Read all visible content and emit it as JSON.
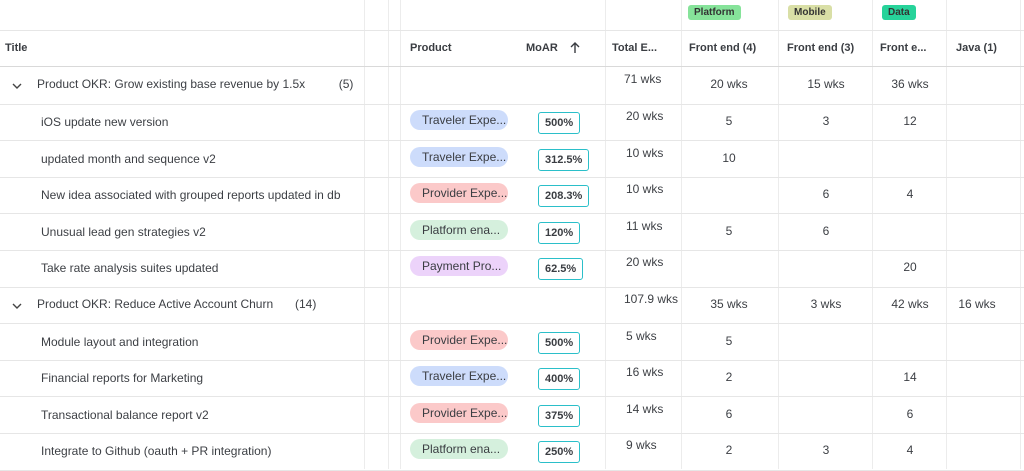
{
  "teams": [
    {
      "label": "Platform",
      "color": "#86e39a"
    },
    {
      "label": "Mobile",
      "color": "#d9dfa6"
    },
    {
      "label": "Data",
      "color": "#27d39a"
    }
  ],
  "columns": {
    "title": "Title",
    "product": "Product",
    "moar": "MoAR",
    "total": "Total E...",
    "fe_platform": "Front end (4)",
    "fe_mobile": "Front end (3)",
    "fe_data": "Front e...",
    "java": "Java (1)"
  },
  "colors": {
    "traveler": "#cddcfb",
    "provider": "#fbc9c9",
    "platform": "#d5f0dd",
    "payment": "#ecd3fa",
    "moar_border": "#2bbfc9"
  },
  "groups": [
    {
      "title": "Product OKR: Grow existing base revenue by 1.5x",
      "count": "(5)",
      "total": "71 wks",
      "fe_platform": "20 wks",
      "fe_mobile": "15 wks",
      "fe_data": "36 wks",
      "java": "",
      "rows": [
        {
          "title": "iOS update new version",
          "product": "Traveler Expe...",
          "kind": "traveler",
          "moar": "500%",
          "total": "20 wks",
          "fe_platform": "5",
          "fe_mobile": "3",
          "fe_data": "12",
          "java": ""
        },
        {
          "title": "updated month and sequence v2",
          "product": "Traveler Expe...",
          "kind": "traveler",
          "moar": "312.5%",
          "total": "10 wks",
          "fe_platform": "10",
          "fe_mobile": "",
          "fe_data": "",
          "java": ""
        },
        {
          "title": "New idea associated with grouped reports updated in db",
          "product": "Provider Expe...",
          "kind": "provider",
          "moar": "208.3%",
          "total": "10 wks",
          "fe_platform": "",
          "fe_mobile": "6",
          "fe_data": "4",
          "java": ""
        },
        {
          "title": "Unusual lead gen strategies v2",
          "product": "Platform ena...",
          "kind": "platform",
          "moar": "120%",
          "total": "11 wks",
          "fe_platform": "5",
          "fe_mobile": "6",
          "fe_data": "",
          "java": ""
        },
        {
          "title": "Take rate analysis suites updated",
          "product": "Payment Pro...",
          "kind": "payment",
          "moar": "62.5%",
          "total": "20 wks",
          "fe_platform": "",
          "fe_mobile": "",
          "fe_data": "20",
          "java": ""
        }
      ]
    },
    {
      "title": "Product OKR: Reduce Active Account Churn",
      "count": "(14)",
      "total": "107.9 wks",
      "fe_platform": "35 wks",
      "fe_mobile": "3 wks",
      "fe_data": "42 wks",
      "java": "16 wks",
      "rows": [
        {
          "title": "Module layout and integration",
          "product": "Provider Expe...",
          "kind": "provider",
          "moar": "500%",
          "total": "5 wks",
          "fe_platform": "5",
          "fe_mobile": "",
          "fe_data": "",
          "java": ""
        },
        {
          "title": "Financial reports for Marketing",
          "product": "Traveler Expe...",
          "kind": "traveler",
          "moar": "400%",
          "total": "16 wks",
          "fe_platform": "2",
          "fe_mobile": "",
          "fe_data": "14",
          "java": ""
        },
        {
          "title": "Transactional balance report v2",
          "product": "Provider Expe...",
          "kind": "provider",
          "moar": "375%",
          "total": "14 wks",
          "fe_platform": "6",
          "fe_mobile": "",
          "fe_data": "6",
          "java": ""
        },
        {
          "title": "Integrate to Github (oauth + PR integration)",
          "product": "Platform ena...",
          "kind": "platform",
          "moar": "250%",
          "total": "9 wks",
          "fe_platform": "2",
          "fe_mobile": "3",
          "fe_data": "4",
          "java": ""
        }
      ]
    }
  ]
}
